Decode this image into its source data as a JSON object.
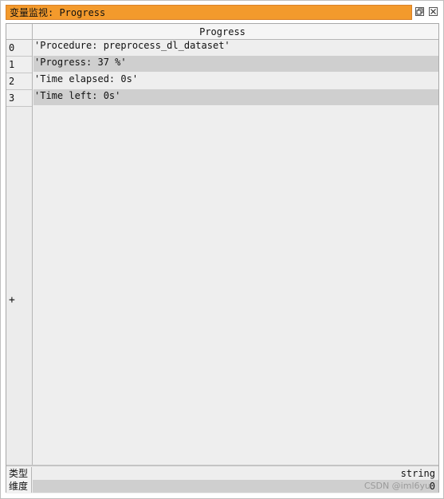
{
  "window": {
    "title": "变量监视: Progress"
  },
  "icons": {
    "restore": "restore-window-icon",
    "close": "close-icon"
  },
  "table": {
    "column_header": "Progress",
    "rows": [
      {
        "index": "0",
        "value": "'Procedure: preprocess_dl_dataset'"
      },
      {
        "index": "1",
        "value": "'Progress: 37 %'"
      },
      {
        "index": "2",
        "value": "'Time elapsed: 0s'"
      },
      {
        "index": "3",
        "value": "'Time left: 0s'"
      }
    ],
    "expand_marker": "+"
  },
  "footer": {
    "type_label": "类型",
    "type_value": "string",
    "dimension_label": "维度",
    "dimension_value": "0"
  },
  "watermark": "CSDN @iml6yu",
  "colors": {
    "title_bar": "#f39a2c",
    "alt_row": "#cfcfcf",
    "grid_bg": "#eeeeee"
  }
}
